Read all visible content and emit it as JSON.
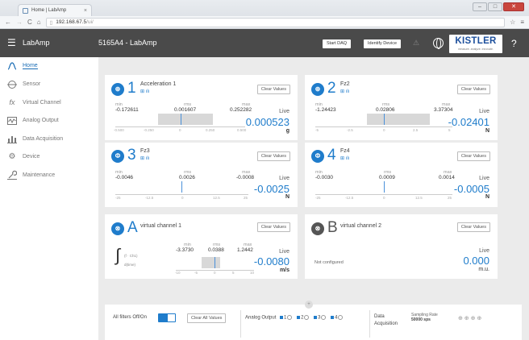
{
  "browser": {
    "tab_title": "Home | LabAmp",
    "tab_close": "×",
    "url_host": "192.168.67.5",
    "url_path": "/ui/",
    "win_min": "–",
    "win_max": "□",
    "win_close": "✕"
  },
  "header": {
    "app_name": "LabAmp",
    "device_name": "5165A4 - LabAmp",
    "start_daq_label": "Start DAQ",
    "identify_label": "Identify Device",
    "logo_text": "KISTLER",
    "logo_tagline": "measure. analyze. innovate.",
    "help": "?"
  },
  "sidebar": {
    "items": [
      {
        "label": "Home",
        "icon": "home-icon"
      },
      {
        "label": "Sensor",
        "icon": "sensor-icon"
      },
      {
        "label": "Virtual Channel",
        "icon": "fx-icon"
      },
      {
        "label": "Analog Output",
        "icon": "waveform-icon"
      },
      {
        "label": "Data Acquisition",
        "icon": "bar-chart-icon"
      },
      {
        "label": "Device",
        "icon": "gear-icon"
      },
      {
        "label": "Maintenance",
        "icon": "wrench-icon"
      }
    ]
  },
  "channels": [
    {
      "num": "1",
      "name": "Acceleration 1",
      "clear": "Clear Values",
      "min_label": "min",
      "min": "-0.172611",
      "rms_label": "rms",
      "rms": "0.001607",
      "max_label": "max",
      "max": "0.252282",
      "live_label": "Live",
      "live": "0.000523",
      "unit": "g",
      "ticks": [
        "-0.500",
        "-0.250",
        "0",
        "0.250",
        "0.500"
      ],
      "bar_min": 0.327,
      "bar_max": 0.752,
      "marker": 0.501
    },
    {
      "num": "2",
      "name": "Fz2",
      "clear": "Clear Values",
      "min_label": "min",
      "min": "-1.24423",
      "rms_label": "rms",
      "rms": "0.02806",
      "max_label": "max",
      "max": "3.37304",
      "live_label": "Live",
      "live": "-0.02401",
      "unit": "N",
      "ticks": [
        "-5",
        "-2.5",
        "0",
        "2.5",
        "5"
      ],
      "bar_min": 0.376,
      "bar_max": 0.837,
      "marker": 0.498
    },
    {
      "num": "3",
      "name": "Fz3",
      "clear": "Clear Values",
      "min_label": "min",
      "min": "-0.0046",
      "rms_label": "rms",
      "rms": "0.0026",
      "max_label": "max",
      "max": "-0.0008",
      "live_label": "Live",
      "live": "-0.0025",
      "unit": "N",
      "ticks": [
        "-25",
        "-12.5",
        "0",
        "12.5",
        "25"
      ],
      "bar_min": 0.4999,
      "bar_max": 0.5,
      "marker": 0.4999
    },
    {
      "num": "4",
      "name": "Fz4",
      "clear": "Clear Values",
      "min_label": "min",
      "min": "-0.0030",
      "rms_label": "rms",
      "rms": "0.0009",
      "max_label": "max",
      "max": "0.0014",
      "live_label": "Live",
      "live": "-0.0005",
      "unit": "N",
      "ticks": [
        "-25",
        "-12.5",
        "0",
        "12.5",
        "25"
      ],
      "bar_min": 0.4999,
      "bar_max": 0.5,
      "marker": 0.4999
    }
  ],
  "virtual": [
    {
      "letter": "A",
      "name": "virtual channel 1",
      "clear": "Clear Values",
      "min_label": "min",
      "min": "-3.3730",
      "rms_label": "rms",
      "rms": "0.0388",
      "max_label": "max",
      "max": "1.2442",
      "live_label": "Live",
      "live": "-0.0080",
      "unit": "m/s",
      "formula": "(f · Ch1)",
      "formula_sub": "d(time)",
      "ticks": [
        "-10",
        "-5",
        "0",
        "5",
        "10"
      ],
      "bar_min": 0.331,
      "bar_max": 0.562,
      "marker": 0.4996
    },
    {
      "letter": "B",
      "name": "virtual channel 2",
      "clear": "Clear Values",
      "not_configured": "Not configured",
      "live_label": "Live",
      "live": "0.000",
      "unit": "m.u."
    }
  ],
  "bottom": {
    "filters_label": "All filters Off/On",
    "clear_all": "Clear All Values",
    "analog_output": "Analog Output",
    "ao_nums": [
      "1",
      "2",
      "3",
      "4"
    ],
    "data_acq_line1": "Data",
    "data_acq_line2": "Acquisition",
    "sampling_label": "Sampling Rate",
    "sampling_value": "50000 sps"
  }
}
